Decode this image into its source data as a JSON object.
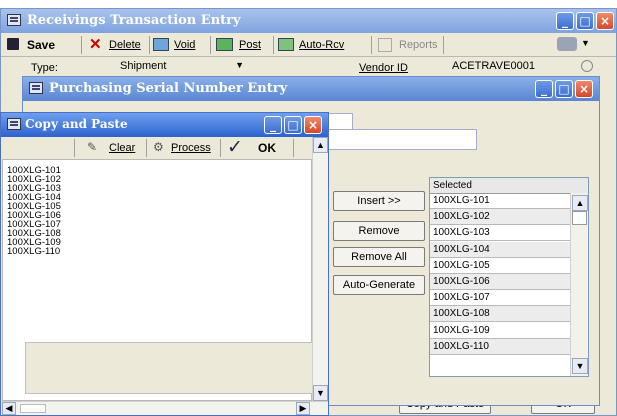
{
  "receivings": {
    "title": "Receivings Transaction Entry",
    "toolbar": {
      "save": "Save",
      "delete": "Delete",
      "void": "Void",
      "post": "Post",
      "auto_rcv": "Auto-Rcv",
      "reports": "Reports"
    },
    "type_label": "Type:",
    "type_value": "Shipment",
    "vendor_label": "Vendor ID",
    "vendor_value": "ACETRAVE0001",
    "copy_paste_btn": "Copy and Paste",
    "ok_btn": "OK"
  },
  "purchasing": {
    "title": "Purchasing Serial Number Entry",
    "selected_header": "Selected",
    "buttons": {
      "insert": "Insert >>",
      "remove": "Remove",
      "remove_all": "Remove All",
      "auto_generate": "Auto-Generate"
    },
    "selected": [
      "100XLG-101",
      "100XLG-102",
      "100XLG-103",
      "100XLG-104",
      "100XLG-105",
      "100XLG-106",
      "100XLG-107",
      "100XLG-108",
      "100XLG-109",
      "100XLG-110"
    ]
  },
  "copy_paste": {
    "title": "Copy and Paste",
    "clear": "Clear",
    "process": "Process",
    "ok": "OK",
    "lines": [
      "100XLG-101",
      "100XLG-102",
      "100XLG-103",
      "100XLG-104",
      "100XLG-105",
      "100XLG-106",
      "100XLG-107",
      "100XLG-108",
      "100XLG-109",
      "100XLG-110"
    ]
  }
}
